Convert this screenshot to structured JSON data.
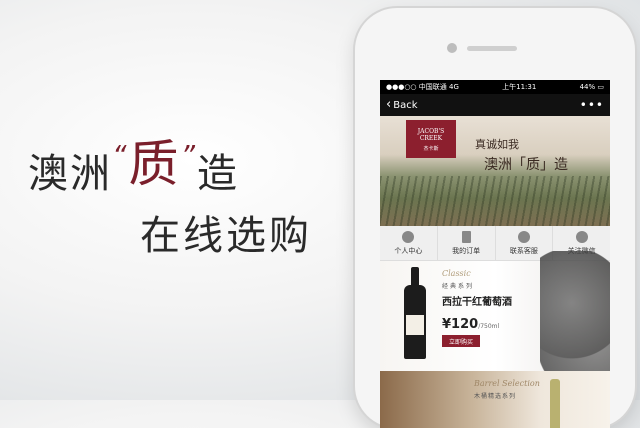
{
  "promo": {
    "line1_a": "澳洲",
    "quote_open": "“",
    "accent": "质",
    "quote_close": "”",
    "line1_b": "造",
    "line2": "在线选购"
  },
  "status_bar": {
    "carrier": "中国联通",
    "network": "4G",
    "time": "上午11:31",
    "battery": "44%"
  },
  "nav": {
    "back_label": "Back",
    "more_icon": "more-dots-icon"
  },
  "hero": {
    "logo_text": "JACOB'S CREEK",
    "logo_sub": "杰卡斯",
    "title1": "真诚如我",
    "title2": "澳洲「质」造"
  },
  "menu": [
    {
      "label": "个人中心",
      "icon": "user-icon"
    },
    {
      "label": "我的订单",
      "icon": "order-icon"
    },
    {
      "label": "联系客服",
      "icon": "service-icon"
    },
    {
      "label": "关注微信",
      "icon": "wechat-icon"
    }
  ],
  "product": {
    "script": "Classic",
    "series": "经典系列",
    "name": "西拉干红葡萄酒",
    "price": "¥120",
    "unit": "/750ml",
    "buy_label": "立即购买"
  },
  "product2": {
    "script": "Barrel Selection",
    "series": "木桶精选系列"
  }
}
